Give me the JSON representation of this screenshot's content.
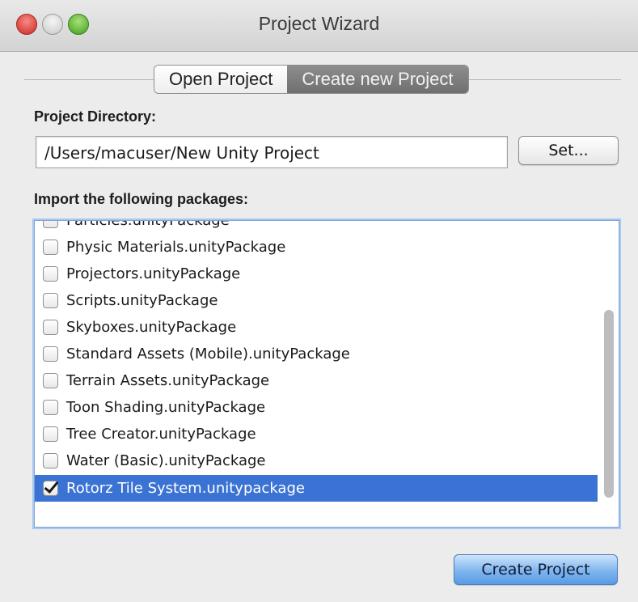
{
  "window": {
    "title": "Project Wizard"
  },
  "tabs": [
    {
      "label": "Open Project",
      "active": false
    },
    {
      "label": "Create new Project",
      "active": true
    }
  ],
  "directory": {
    "label": "Project Directory:",
    "value": "/Users/macuser/New Unity Project",
    "set_button": "Set..."
  },
  "packages": {
    "label": "Import the following packages:",
    "items": [
      {
        "name": "Particles.unityPackage",
        "checked": false
      },
      {
        "name": "Physic Materials.unityPackage",
        "checked": false
      },
      {
        "name": "Projectors.unityPackage",
        "checked": false
      },
      {
        "name": "Scripts.unityPackage",
        "checked": false
      },
      {
        "name": "Skyboxes.unityPackage",
        "checked": false
      },
      {
        "name": "Standard Assets (Mobile).unityPackage",
        "checked": false
      },
      {
        "name": "Terrain Assets.unityPackage",
        "checked": false
      },
      {
        "name": "Toon Shading.unityPackage",
        "checked": false
      },
      {
        "name": "Tree Creator.unityPackage",
        "checked": false
      },
      {
        "name": "Water (Basic).unityPackage",
        "checked": false
      },
      {
        "name": "Rotorz Tile System.unitypackage",
        "checked": true
      }
    ]
  },
  "actions": {
    "create_button": "Create Project"
  },
  "colors": {
    "selection": "#3b73d4",
    "primary_button": "#7fb5ef"
  }
}
